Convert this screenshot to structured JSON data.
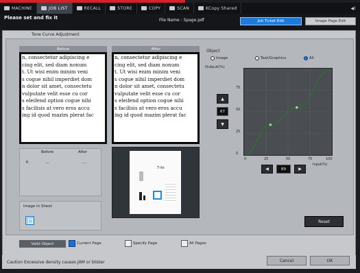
{
  "tabs": [
    {
      "label": "MACHINE"
    },
    {
      "label": "JOB LIST"
    },
    {
      "label": "RECALL"
    },
    {
      "label": "STORE"
    },
    {
      "label": "COPY"
    },
    {
      "label": "SCAN"
    },
    {
      "label": "KCopy Shared"
    }
  ],
  "header": {
    "message_line1": "Please set and fix it",
    "file_label": "File Name : 5page.pdf",
    "job_ticket_button": "Job Ticket Edit",
    "image_page_button": "Image Page Edit"
  },
  "panel": {
    "title": "Tone Curve Adjustment"
  },
  "before": {
    "label": "Before",
    "lines": [
      "n, consectetur adipiscing e",
      "cing elit, sed diam nonum",
      "t. Ut wisi enim minim veni",
      "s cogue nihil imperdiet dom",
      "n dolor sit amet, consectetu",
      "vulputate velit esse cu cor",
      "s eleifend option cogue nihi",
      "s facilisis at vero eros accu",
      "ing id quod mazim plerat fac"
    ]
  },
  "after": {
    "label": "After",
    "lines": [
      "n, consectetur adipiscing e",
      "cing elit, sed diam nonum",
      "t. Ut wisi enim minim veni",
      "s cogue nihil imperdiet dom",
      "n dolor sit amet, consectetu",
      "vulputate velit esse cu cor",
      "s eleifend option cogue nihi",
      "s facilisis at vero eros accu",
      "ing id quod mazim plerat fac"
    ]
  },
  "density": {
    "before_label": "Before",
    "after_label": "After",
    "row_label": "K",
    "before_value": "---",
    "after_value": "---"
  },
  "image_in_sheet": {
    "label": "Image In Sheet"
  },
  "preview": {
    "page_text": "T-ite"
  },
  "object": {
    "label": "Object",
    "options": [
      "Image",
      "Text/Graphics",
      "All"
    ],
    "selected": "All"
  },
  "graph": {
    "output_label": "Output(%)",
    "input_label": "Input(%)",
    "y_ticks": [
      "100",
      "75",
      "50",
      "25",
      "0"
    ],
    "x_ticks": [
      "0",
      "25",
      "50",
      "75",
      "100"
    ],
    "output_value": "67",
    "input_value": "89",
    "up_arrow": "▲",
    "down_arrow": "▼",
    "left_arrow": "◀",
    "right_arrow": "▶"
  },
  "reset_button": "Reset",
  "apply": {
    "label": "Valid Object",
    "options": [
      "Current Page",
      "Specify Page",
      "All Pages"
    ],
    "selected": "Current Page"
  },
  "footer": {
    "caution": "Caution Excessive density causes JAM or blister",
    "cancel": "Cancel",
    "ok": "OK"
  },
  "chart_data": {
    "type": "line",
    "title": "",
    "xlabel": "Input(%)",
    "ylabel": "Output(%)",
    "xlim": [
      0,
      100
    ],
    "ylim": [
      0,
      100
    ],
    "series": [
      {
        "values": [
          [
            0,
            0
          ],
          [
            30,
            35
          ],
          [
            60,
            55
          ],
          [
            100,
            100
          ]
        ]
      }
    ]
  }
}
